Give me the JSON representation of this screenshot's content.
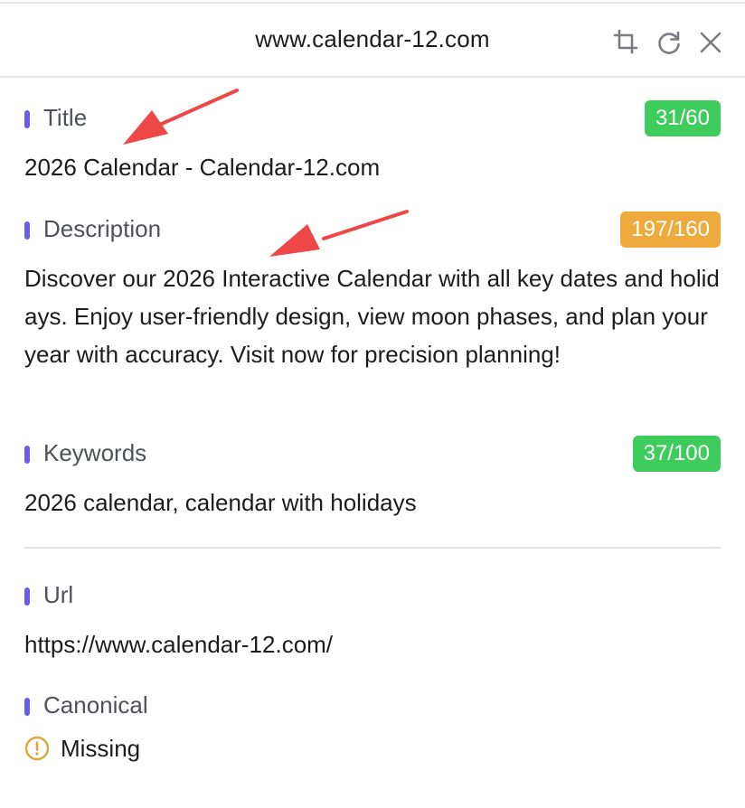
{
  "header": {
    "title": "www.calendar-12.com",
    "icons": [
      "crop-icon",
      "refresh-icon",
      "close-icon"
    ]
  },
  "fields": {
    "title": {
      "label": "Title",
      "count": "31/60",
      "status_color": "#3ecd5d",
      "value": "2026 Calendar - Calendar-12.com"
    },
    "description": {
      "label": "Description",
      "count": "197/160",
      "status_color": "#eeaa3c",
      "value": "Discover our 2026 Interactive Calendar with all key dates and holidays. Enjoy user-friendly design, view moon phases, and plan your year with accuracy. Visit now for precision planning!"
    },
    "keywords": {
      "label": "Keywords",
      "count": "37/100",
      "status_color": "#3ecd5d",
      "value": "2026 calendar, calendar with holidays"
    },
    "url": {
      "label": "Url",
      "value": "https://www.calendar-12.com/"
    },
    "canonical": {
      "label": "Canonical",
      "value": "Missing",
      "icon": "warning-circle-icon"
    }
  },
  "colors": {
    "accent": "#6a5cf0",
    "ok": "#3ecd5d",
    "warn": "#eeaa3c",
    "annotation": "#ee4747"
  }
}
